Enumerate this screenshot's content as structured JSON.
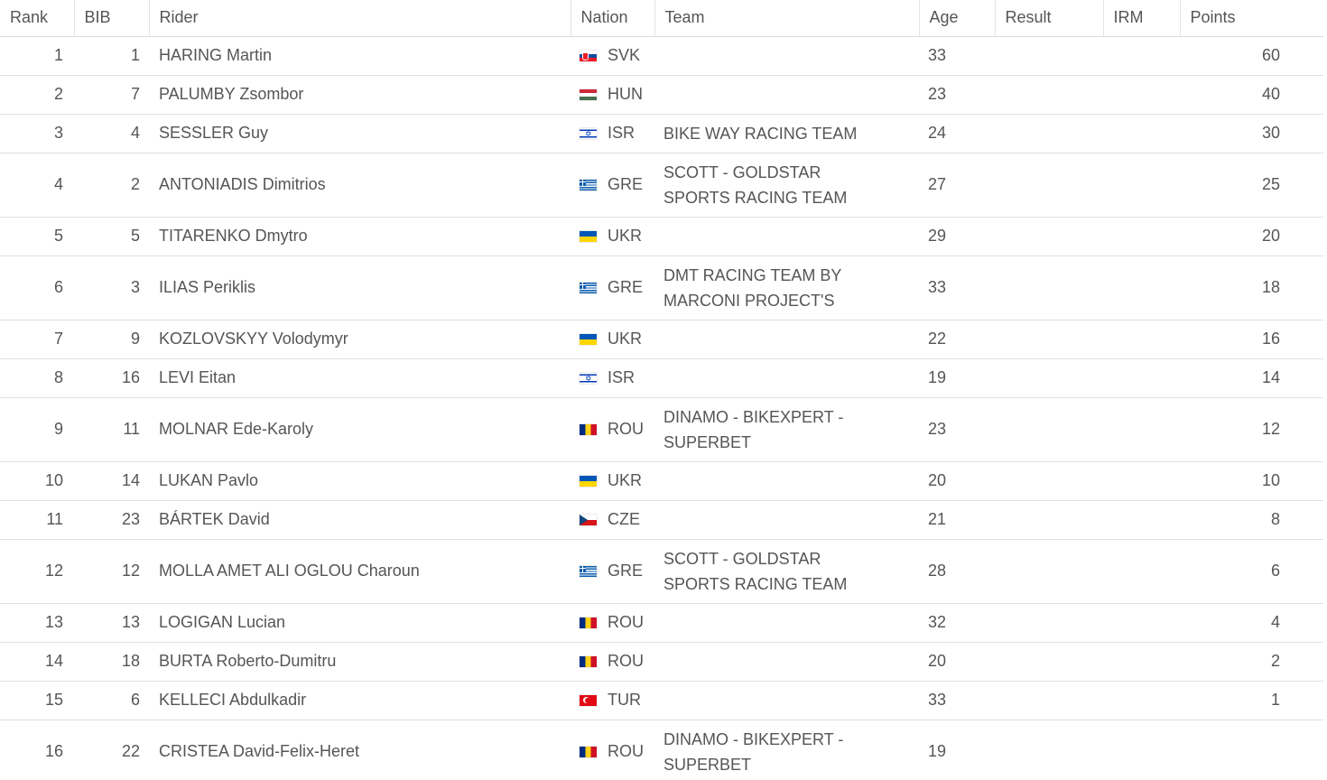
{
  "headers": {
    "rank": "Rank",
    "bib": "BIB",
    "rider": "Rider",
    "nation": "Nation",
    "team": "Team",
    "age": "Age",
    "result": "Result",
    "irm": "IRM",
    "points": "Points"
  },
  "rows": [
    {
      "rank": "1",
      "bib": "1",
      "rider": "HARING Martin",
      "flag": "svk-flag-icon",
      "nation": "SVK",
      "team": "",
      "age": "33",
      "result": "",
      "irm": "",
      "points": "60"
    },
    {
      "rank": "2",
      "bib": "7",
      "rider": "PALUMBY Zsombor",
      "flag": "hun-flag-icon",
      "nation": "HUN",
      "team": "",
      "age": "23",
      "result": "",
      "irm": "",
      "points": "40"
    },
    {
      "rank": "3",
      "bib": "4",
      "rider": "SESSLER Guy",
      "flag": "isr-flag-icon",
      "nation": "ISR",
      "team": "BIKE WAY RACING TEAM",
      "age": "24",
      "result": "",
      "irm": "",
      "points": "30"
    },
    {
      "rank": "4",
      "bib": "2",
      "rider": "ANTONIADIS Dimitrios",
      "flag": "gre-flag-icon",
      "nation": "GRE",
      "team": "SCOTT - GOLDSTAR SPORTS RACING TEAM",
      "age": "27",
      "result": "",
      "irm": "",
      "points": "25"
    },
    {
      "rank": "5",
      "bib": "5",
      "rider": "TITARENKO Dmytro",
      "flag": "ukr-flag-icon",
      "nation": "UKR",
      "team": "",
      "age": "29",
      "result": "",
      "irm": "",
      "points": "20"
    },
    {
      "rank": "6",
      "bib": "3",
      "rider": "ILIAS Periklis",
      "flag": "gre-flag-icon",
      "nation": "GRE",
      "team": "DMT RACING TEAM BY MARCONI PROJECT'S",
      "age": "33",
      "result": "",
      "irm": "",
      "points": "18"
    },
    {
      "rank": "7",
      "bib": "9",
      "rider": "KOZLOVSKYY Volodymyr",
      "flag": "ukr-flag-icon",
      "nation": "UKR",
      "team": "",
      "age": "22",
      "result": "",
      "irm": "",
      "points": "16"
    },
    {
      "rank": "8",
      "bib": "16",
      "rider": "LEVI Eitan",
      "flag": "isr-flag-icon",
      "nation": "ISR",
      "team": "",
      "age": "19",
      "result": "",
      "irm": "",
      "points": "14"
    },
    {
      "rank": "9",
      "bib": "11",
      "rider": "MOLNAR Ede-Karoly",
      "flag": "rou-flag-icon",
      "nation": "ROU",
      "team": "DINAMO - BIKEXPERT - SUPERBET",
      "age": "23",
      "result": "",
      "irm": "",
      "points": "12"
    },
    {
      "rank": "10",
      "bib": "14",
      "rider": "LUKAN Pavlo",
      "flag": "ukr-flag-icon",
      "nation": "UKR",
      "team": "",
      "age": "20",
      "result": "",
      "irm": "",
      "points": "10"
    },
    {
      "rank": "11",
      "bib": "23",
      "rider": "BÁRTEK David",
      "flag": "cze-flag-icon",
      "nation": "CZE",
      "team": "",
      "age": "21",
      "result": "",
      "irm": "",
      "points": "8"
    },
    {
      "rank": "12",
      "bib": "12",
      "rider": "MOLLA AMET ALI OGLOU Charoun",
      "flag": "gre-flag-icon",
      "nation": "GRE",
      "team": "SCOTT - GOLDSTAR SPORTS RACING TEAM",
      "age": "28",
      "result": "",
      "irm": "",
      "points": "6"
    },
    {
      "rank": "13",
      "bib": "13",
      "rider": "LOGIGAN Lucian",
      "flag": "rou-flag-icon",
      "nation": "ROU",
      "team": "",
      "age": "32",
      "result": "",
      "irm": "",
      "points": "4"
    },
    {
      "rank": "14",
      "bib": "18",
      "rider": "BURTA Roberto-Dumitru",
      "flag": "rou-flag-icon",
      "nation": "ROU",
      "team": "",
      "age": "20",
      "result": "",
      "irm": "",
      "points": "2"
    },
    {
      "rank": "15",
      "bib": "6",
      "rider": "KELLECI Abdulkadir",
      "flag": "tur-flag-icon",
      "nation": "TUR",
      "team": "",
      "age": "33",
      "result": "",
      "irm": "",
      "points": "1"
    },
    {
      "rank": "16",
      "bib": "22",
      "rider": "CRISTEA David-Felix-Heret",
      "flag": "rou-flag-icon",
      "nation": "ROU",
      "team": "DINAMO - BIKEXPERT - SUPERBET",
      "age": "19",
      "result": "",
      "irm": "",
      "points": ""
    }
  ]
}
